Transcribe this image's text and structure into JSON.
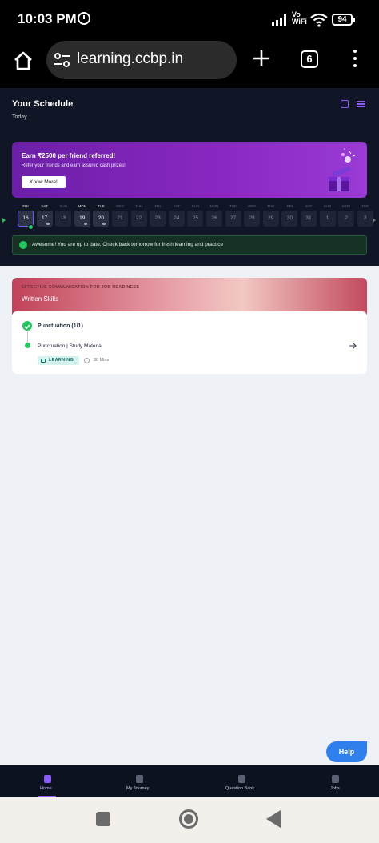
{
  "status_bar": {
    "time": "10:03 PM",
    "network_label": "Vo WiFi",
    "battery": "94"
  },
  "browser": {
    "url": "learning.ccbp.in",
    "tab_count": "6"
  },
  "schedule": {
    "title": "Your Schedule",
    "subtitle": "Today",
    "banner": {
      "title": "Earn ₹2500 per friend referred!",
      "subtitle": "Refer your friends and earn assured cash prizes!",
      "button": "Know More!"
    },
    "days": [
      {
        "name": "FRI",
        "num": "16",
        "state": "selected"
      },
      {
        "name": "SAT",
        "num": "17",
        "state": "locked"
      },
      {
        "name": "SUN",
        "num": "18",
        "state": "inactive"
      },
      {
        "name": "MON",
        "num": "19",
        "state": "locked"
      },
      {
        "name": "TUE",
        "num": "20",
        "state": "locked"
      },
      {
        "name": "WED",
        "num": "21",
        "state": "inactive"
      },
      {
        "name": "THU",
        "num": "22",
        "state": "inactive"
      },
      {
        "name": "FRI",
        "num": "23",
        "state": "inactive"
      },
      {
        "name": "SAT",
        "num": "24",
        "state": "inactive"
      },
      {
        "name": "SUN",
        "num": "25",
        "state": "inactive"
      },
      {
        "name": "MON",
        "num": "26",
        "state": "inactive"
      },
      {
        "name": "TUE",
        "num": "27",
        "state": "inactive"
      },
      {
        "name": "WED",
        "num": "28",
        "state": "inactive"
      },
      {
        "name": "THU",
        "num": "29",
        "state": "inactive"
      },
      {
        "name": "FRI",
        "num": "30",
        "state": "inactive"
      },
      {
        "name": "SAT",
        "num": "31",
        "state": "inactive"
      },
      {
        "name": "SUN",
        "num": "1",
        "state": "inactive"
      },
      {
        "name": "MON",
        "num": "2",
        "state": "inactive"
      },
      {
        "name": "TUE",
        "num": "3",
        "state": "inactive"
      }
    ],
    "alert": "Awesome! You are up to date. Check back tomorrow for fresh learning and practice"
  },
  "course": {
    "tag": "EFFECTIVE COMMUNICATION FOR JOB READINESS",
    "name": "Written Skills",
    "unit_title": "Punctuation (1/1)",
    "item_title": "Punctuation | Study Material",
    "item_tag": "LEARNING",
    "item_time": "30 Mins"
  },
  "help_label": "Help",
  "bottom_nav": [
    {
      "label": "Home",
      "icon": "home-icon",
      "active": true
    },
    {
      "label": "My Journey",
      "icon": "journey-icon",
      "active": false
    },
    {
      "label": "Question Bank",
      "icon": "code-icon",
      "active": false
    },
    {
      "label": "Jobs",
      "icon": "briefcase-icon",
      "active": false
    }
  ],
  "colors": {
    "accent": "#8b5cf6",
    "success": "#22c55e",
    "help": "#2f80ed",
    "banner": "#8a28c2"
  }
}
